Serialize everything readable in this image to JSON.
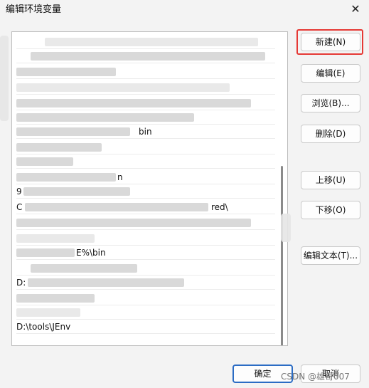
{
  "window": {
    "title": "编辑环境变量",
    "close_glyph": "✕"
  },
  "list": {
    "rows": [
      {
        "text": ""
      },
      {
        "text": ""
      },
      {
        "text": ""
      },
      {
        "text": ""
      },
      {
        "text": "bin"
      },
      {
        "text": ""
      },
      {
        "text": ""
      },
      {
        "text": "n"
      },
      {
        "text": "9"
      },
      {
        "text": "C"
      },
      {
        "text": "red\\"
      },
      {
        "text": "E%\\bin"
      },
      {
        "text": ""
      },
      {
        "text": ""
      },
      {
        "text": "D:"
      },
      {
        "text": ""
      },
      {
        "text": ""
      },
      {
        "text": "D:\\tools\\JEnv"
      }
    ]
  },
  "buttons": {
    "new": "新建(N)",
    "edit": "编辑(E)",
    "browse": "浏览(B)...",
    "delete": "删除(D)",
    "move_up": "上移(U)",
    "move_down": "下移(O)",
    "edit_text": "编辑文本(T)...",
    "ok": "确定",
    "cancel": "取消"
  },
  "watermark": "CSDN @雄哥007",
  "colors": {
    "highlight": "#e53935",
    "ok_border": "#2b6cc4"
  }
}
